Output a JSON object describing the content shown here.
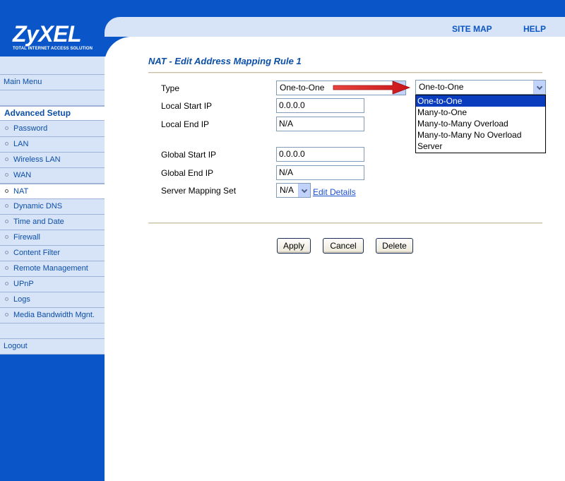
{
  "brand": {
    "logo": "ZyXEL",
    "tagline": "TOTAL INTERNET ACCESS SOLUTION"
  },
  "header": {
    "site_map": "SITE MAP",
    "help": "HELP"
  },
  "sidebar": {
    "main_menu": "Main Menu",
    "advanced_setup": "Advanced Setup",
    "items": [
      {
        "label": "Password"
      },
      {
        "label": "LAN"
      },
      {
        "label": "Wireless LAN"
      },
      {
        "label": "WAN"
      },
      {
        "label": "NAT"
      },
      {
        "label": "Dynamic DNS"
      },
      {
        "label": "Time and Date"
      },
      {
        "label": "Firewall"
      },
      {
        "label": "Content Filter"
      },
      {
        "label": "Remote Management"
      },
      {
        "label": "UPnP"
      },
      {
        "label": "Logs"
      },
      {
        "label": "Media Bandwidth Mgnt."
      }
    ],
    "active_item": "NAT",
    "logout": "Logout"
  },
  "main": {
    "title": "NAT - Edit Address Mapping Rule 1",
    "form": {
      "type_label": "Type",
      "type_value": "One-to-One",
      "local_start_label": "Local Start IP",
      "local_start_value": "0.0.0.0",
      "local_end_label": "Local End IP",
      "local_end_value": "N/A",
      "global_start_label": "Global Start IP",
      "global_start_value": "0.0.0.0",
      "global_end_label": "Global End IP",
      "global_end_value": "N/A",
      "server_set_label": "Server Mapping Set",
      "server_set_value": "N/A",
      "edit_details": "Edit Details"
    },
    "type_dropdown": {
      "selected": "One-to-One",
      "options": [
        "One-to-One",
        "Many-to-One",
        "Many-to-Many Overload",
        "Many-to-Many No Overload",
        "Server"
      ],
      "highlighted_option": "One-to-One"
    },
    "buttons": {
      "apply": "Apply",
      "cancel": "Cancel",
      "delete": "Delete"
    }
  },
  "colors": {
    "brand_blue": "#0a55c8",
    "sidebar_bg": "#d7e3f7",
    "link": "#0b4fa8",
    "annotation_arrow": "#e0161b"
  }
}
